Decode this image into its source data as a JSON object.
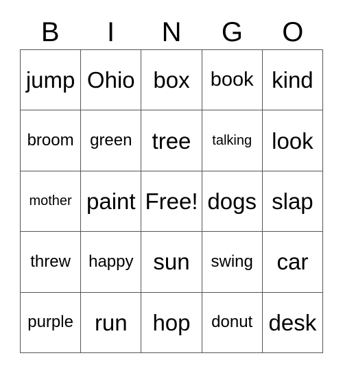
{
  "card": {
    "title_letters": [
      "B",
      "I",
      "N",
      "G",
      "O"
    ],
    "free_space_label": "Free!",
    "grid_size": 5,
    "colors": {
      "background": "#ffffff",
      "text": "#000000",
      "grid_line": "#555555"
    },
    "rows": [
      [
        {
          "text": "jump",
          "size": "fs-xl"
        },
        {
          "text": "Ohio",
          "size": "fs-xl"
        },
        {
          "text": "box",
          "size": "fs-xl"
        },
        {
          "text": "book",
          "size": "fs-lg"
        },
        {
          "text": "kind",
          "size": "fs-xl"
        }
      ],
      [
        {
          "text": "broom",
          "size": "fs-md"
        },
        {
          "text": "green",
          "size": "fs-md"
        },
        {
          "text": "tree",
          "size": "fs-xl"
        },
        {
          "text": "talking",
          "size": "fs-sm"
        },
        {
          "text": "look",
          "size": "fs-xl"
        }
      ],
      [
        {
          "text": "mother",
          "size": "fs-sm"
        },
        {
          "text": "paint",
          "size": "fs-xl"
        },
        {
          "text": "Free!",
          "size": "fs-xl"
        },
        {
          "text": "dogs",
          "size": "fs-xl"
        },
        {
          "text": "slap",
          "size": "fs-xl"
        }
      ],
      [
        {
          "text": "threw",
          "size": "fs-md"
        },
        {
          "text": "happy",
          "size": "fs-md"
        },
        {
          "text": "sun",
          "size": "fs-xl"
        },
        {
          "text": "swing",
          "size": "fs-md"
        },
        {
          "text": "car",
          "size": "fs-xl"
        }
      ],
      [
        {
          "text": "purple",
          "size": "fs-md"
        },
        {
          "text": "run",
          "size": "fs-xl"
        },
        {
          "text": "hop",
          "size": "fs-xl"
        },
        {
          "text": "donut",
          "size": "fs-md"
        },
        {
          "text": "desk",
          "size": "fs-xl"
        }
      ]
    ]
  }
}
